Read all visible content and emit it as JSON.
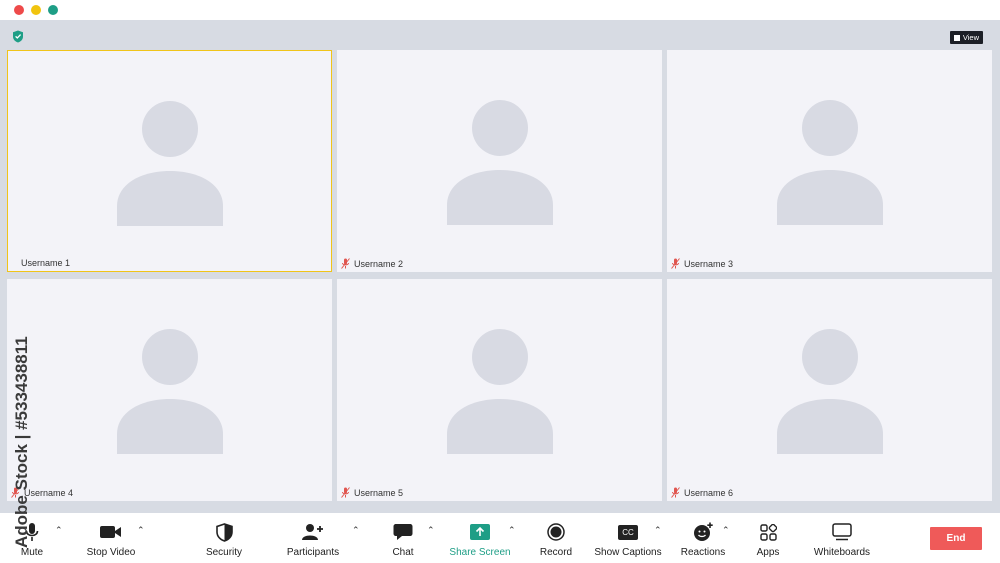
{
  "window": {
    "controls": [
      "close",
      "minimize",
      "maximize"
    ]
  },
  "header": {
    "view_label": "View"
  },
  "participants": [
    {
      "name": "Username 1",
      "muted": false,
      "active": true
    },
    {
      "name": "Username 2",
      "muted": true,
      "active": false
    },
    {
      "name": "Username 3",
      "muted": true,
      "active": false
    },
    {
      "name": "Username 4",
      "muted": true,
      "active": false
    },
    {
      "name": "Username 5",
      "muted": true,
      "active": false
    },
    {
      "name": "Username 6",
      "muted": true,
      "active": false
    }
  ],
  "toolbar": {
    "mute": "Mute",
    "stop_video": "Stop Video",
    "security": "Security",
    "participants": "Participants",
    "chat": "Chat",
    "share_screen": "Share Screen",
    "record": "Record",
    "show_captions": "Show Captions",
    "captions_badge": "CC",
    "reactions": "Reactions",
    "apps": "Apps",
    "whiteboards": "Whiteboards",
    "end": "End"
  },
  "watermark": {
    "text": "Adobe Stock | #533438811"
  },
  "colors": {
    "accent_green": "#1e9e86",
    "active_border": "#f0c419",
    "end_button": "#ef5a59",
    "muted_icon": "#e0554f",
    "avatar": "#d8dae3"
  }
}
